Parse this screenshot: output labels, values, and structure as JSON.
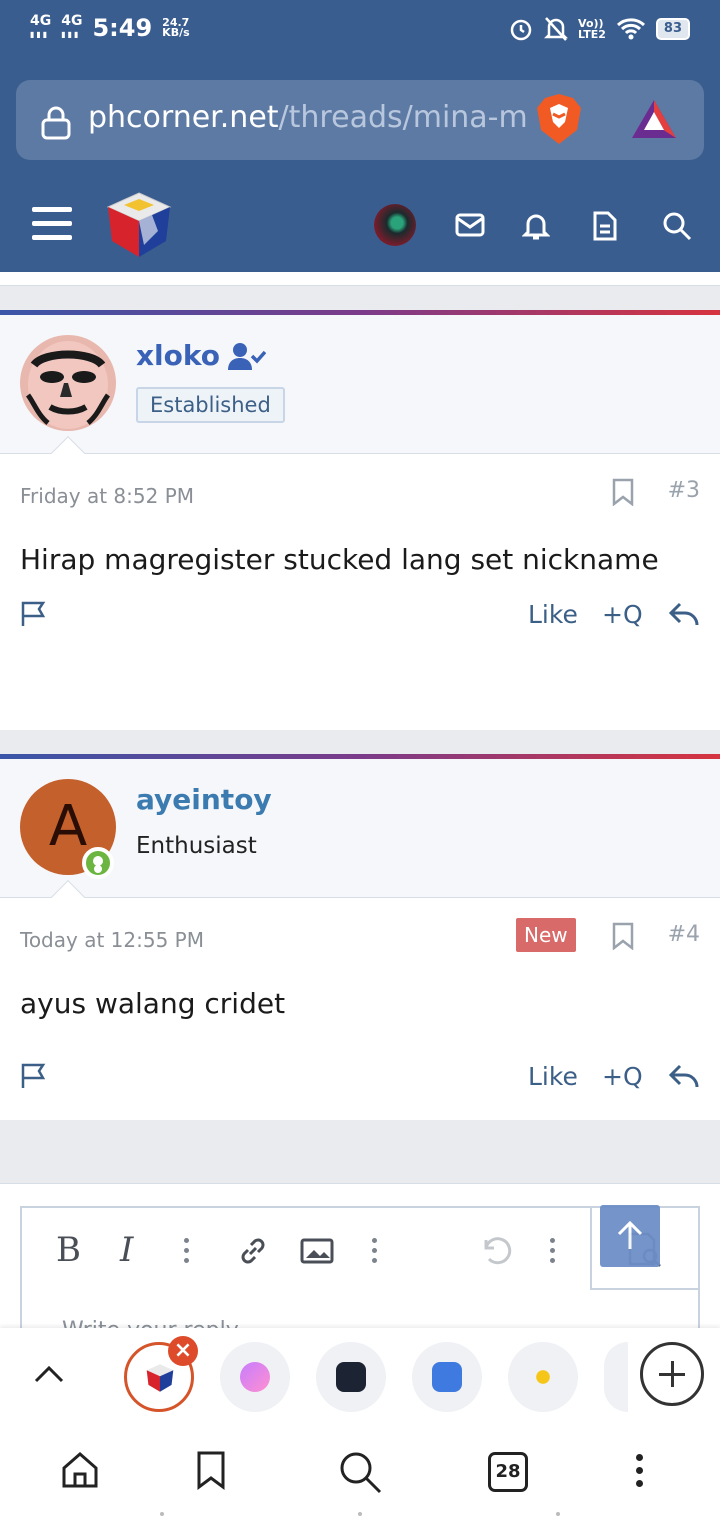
{
  "status_bar": {
    "network1": "4G",
    "network2": "4G",
    "time": "5:49",
    "speed_value": "24.7",
    "speed_unit": "KB/s",
    "volte": "Vo))",
    "lte": "LTE2",
    "battery": "83"
  },
  "browser": {
    "url_host": "phcorner.net",
    "url_path": "/threads/mina-mi"
  },
  "posts": [
    {
      "username": "xloko",
      "user_title": "Established",
      "date": "Friday at 8:52 PM",
      "post_number": "#3",
      "body": "Hirap magregister stucked lang set nickname",
      "like_label": "Like",
      "quote_label": "+Q"
    },
    {
      "username": "ayeintoy",
      "avatar_letter": "A",
      "user_title": "Enthusiast",
      "date": "Today at 12:55 PM",
      "badge": "New",
      "post_number": "#4",
      "body": "ayus walang cridet",
      "like_label": "Like",
      "quote_label": "+Q"
    }
  ],
  "editor": {
    "bold": "B",
    "italic": "I",
    "placeholder": "Write your reply..."
  },
  "tabs": {
    "tab_count": "28"
  },
  "colors": {
    "header_bg": "#3a5d8f",
    "accent_link": "#3a63b8",
    "new_badge": "#d86a6a",
    "online": "#6bb540"
  }
}
